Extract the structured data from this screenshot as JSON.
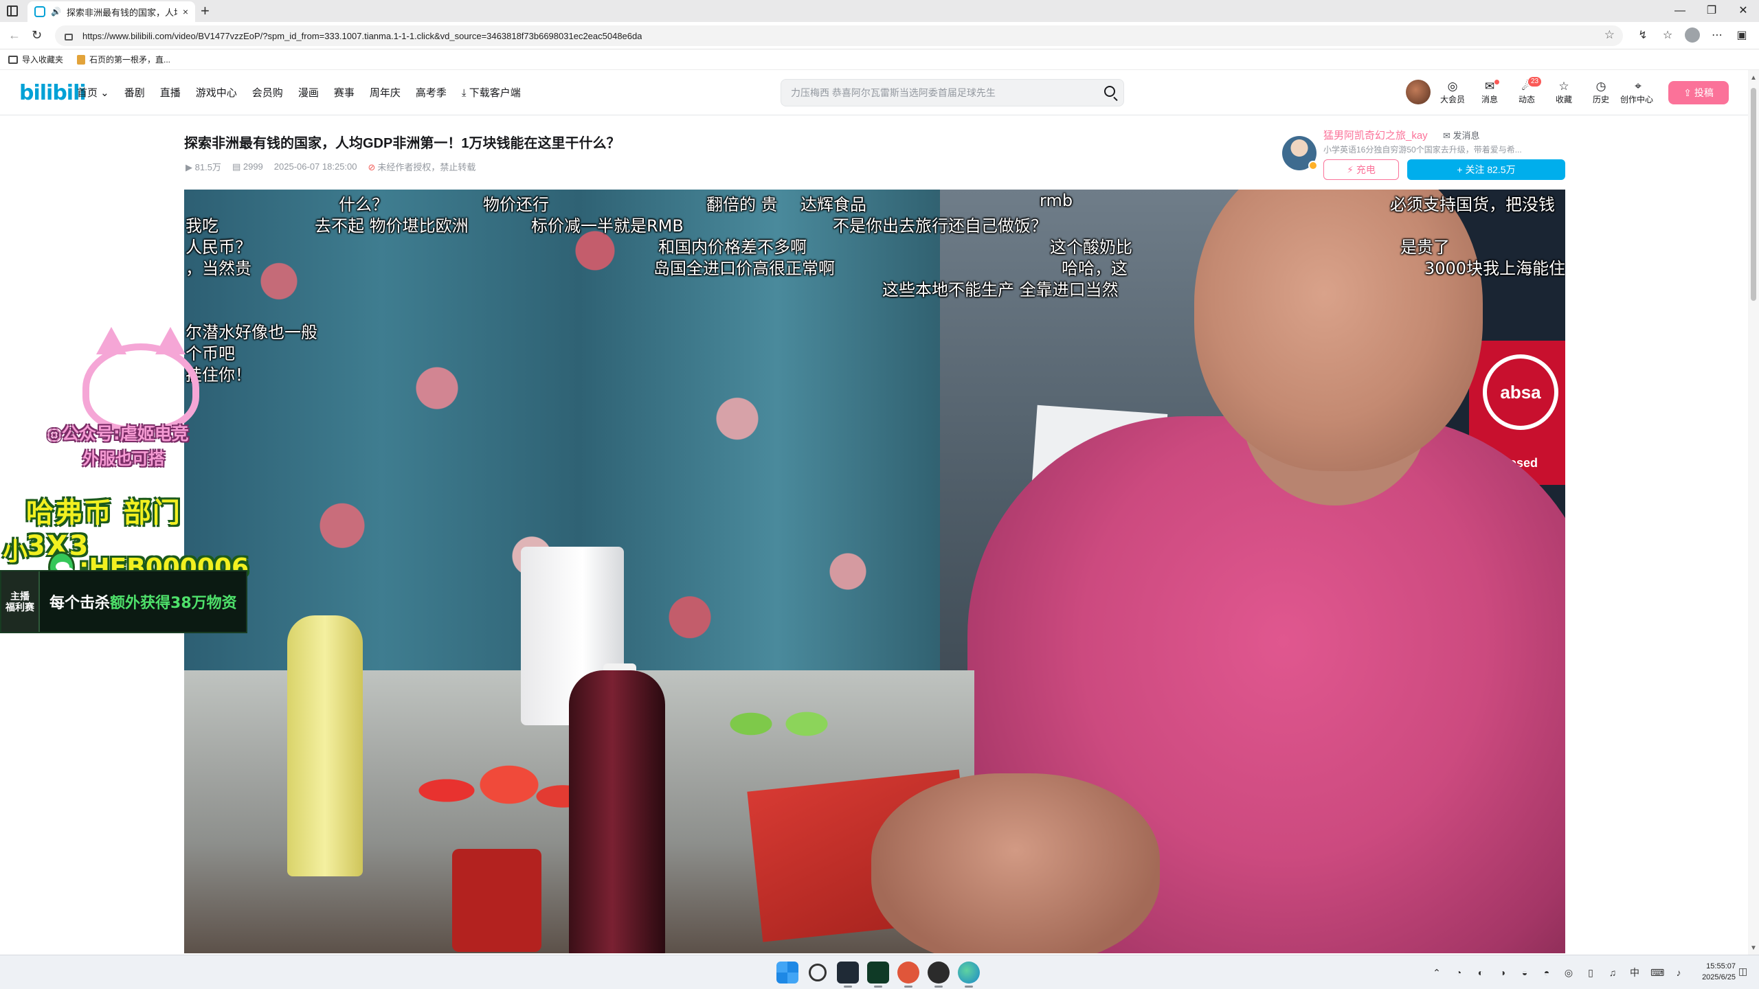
{
  "browser": {
    "tab_title": "探索非洲最有钱的国家，人均",
    "tab_close": "×",
    "new_tab": "+",
    "window_controls": [
      "—",
      "❐",
      "✕"
    ],
    "back": "←",
    "reload": "↻",
    "url": "https://www.bilibili.com/video/BV1477vzzEoP/?spm_id_from=333.1007.tianma.1-1-1.click&vd_source=3463818f73b6698031ec2eac5048e6da",
    "star": "☆",
    "toolbar_icons": [
      "↯",
      "☆",
      "",
      "⋯",
      "▣"
    ],
    "bookmarks": [
      "导入收藏夹",
      "石页的第一根矛，直..."
    ]
  },
  "site": {
    "logo": "bilibili",
    "nav": [
      "首页 ⌄",
      "番剧",
      "直播",
      "游戏中心",
      "会员购",
      "漫画",
      "赛事",
      "周年庆",
      "高考季",
      "下载客户端"
    ],
    "search_placeholder": "力压梅西 恭喜阿尔瓦雷斯当选阿委首届足球先生",
    "right_entries": [
      {
        "icon": "◎",
        "label": "大会员"
      },
      {
        "icon": "✉",
        "label": "消息"
      },
      {
        "icon": "☄",
        "label": "动态",
        "badge": "23"
      },
      {
        "icon": "☆",
        "label": "收藏"
      },
      {
        "icon": "◷",
        "label": "历史"
      },
      {
        "icon": "⌖",
        "label": "创作中心"
      }
    ],
    "upload_icon": "⇪",
    "upload_label": "投稿"
  },
  "video": {
    "title": "探索非洲最有钱的国家，人均GDP非洲第一！1万块钱能在这里干什么？",
    "views": "81.5万",
    "danmaku_count": "2999",
    "date": "2025-06-07 18:25:00",
    "copyright_note": "未经作者授权，禁止转载",
    "view_icon": "▶",
    "dm_icon": "▤",
    "warn_icon": "⊘"
  },
  "uploader": {
    "name": "猛男阿凯奇幻之旅_kay",
    "message_label": "✉ 发消息",
    "description": "小学英语16分独自穷游50个国家去升级，带着爱与希...",
    "charge_label": "⚡ 充电",
    "follow_label": "+ 关注 82.5万"
  },
  "danmaku": [
    {
      "text": "什么？"
    },
    {
      "text": "物价还行"
    },
    {
      "text": "翻倍的 贵"
    },
    {
      "text": "达辉食品"
    },
    {
      "text": "rmb"
    },
    {
      "text": "必须支持国货，把没钱"
    },
    {
      "text": "我吃"
    },
    {
      "text": "去不起 物价堪比欧洲"
    },
    {
      "text": "标价减一半就是RMB"
    },
    {
      "text": "不是你出去旅行还自己做饭？"
    },
    {
      "text": "人民币？"
    },
    {
      "text": "和国内价格差不多啊"
    },
    {
      "text": "这个酸奶比"
    },
    {
      "text": "是贵了"
    },
    {
      "text": "，当然贵"
    },
    {
      "text": "岛国全进口价高很正常啊"
    },
    {
      "text": "哈哈，这"
    },
    {
      "text": "3000块我上海能住"
    },
    {
      "text": "这些本地不能生产 全靠进口当然"
    },
    {
      "text": "尔潜水好像也一般"
    },
    {
      "text": "个币吧"
    },
    {
      "text": "挂住你！"
    }
  ],
  "scene": {
    "absa_sign": "absa",
    "absa_closed": "Closed"
  },
  "overlay": {
    "wechat_line": "◎公众号:虐姬电竞",
    "tagline": "外服也可搭",
    "big_line": "哈弗币 部门 3X3",
    "contact_prefix": "小钰",
    "contact_id": ":HFB000006",
    "badge": "主播\n福利赛",
    "banner_prefix": "每个击杀",
    "banner_highlight": "额外获得38万物资"
  },
  "taskbar": {
    "tray": [
      "⌃",
      "◔",
      "◐",
      "◑",
      "◒",
      "◓",
      "◎",
      "▯",
      "♫",
      "中",
      "⌨",
      "♪"
    ],
    "time": "15:55:07",
    "date": "2025/6/25",
    "notification": "◫"
  }
}
